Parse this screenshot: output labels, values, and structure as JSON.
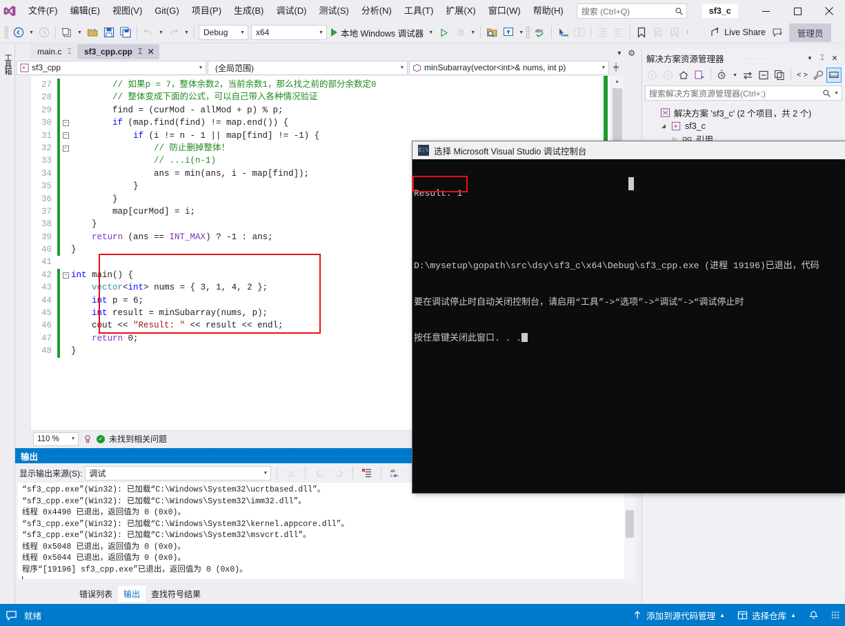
{
  "titlebar": {
    "logo_icon": "visual-studio-logo",
    "menus": [
      {
        "label": "文件(F)"
      },
      {
        "label": "编辑(E)"
      },
      {
        "label": "视图(V)"
      },
      {
        "label": "Git(G)"
      },
      {
        "label": "项目(P)"
      },
      {
        "label": "生成(B)"
      },
      {
        "label": "调试(D)"
      },
      {
        "label": "测试(S)"
      },
      {
        "label": "分析(N)"
      },
      {
        "label": "工具(T)"
      },
      {
        "label": "扩展(X)"
      },
      {
        "label": "窗口(W)"
      },
      {
        "label": "帮助(H)"
      }
    ],
    "search_placeholder": "搜索 (Ctrl+Q)",
    "search_icon": "search-icon",
    "project_chip": "sf3_c",
    "minimize_icon": "minimize-icon",
    "maximize_icon": "maximize-icon",
    "close_icon": "close-icon"
  },
  "toolbar": {
    "back_icon": "navigate-back-icon",
    "forward_icon": "navigate-forward-icon",
    "new_project_icon": "new-project-icon",
    "open_icon": "open-file-icon",
    "save_icon": "save-icon",
    "save_all_icon": "save-all-icon",
    "undo_icon": "undo-icon",
    "redo_icon": "redo-icon",
    "config_value": "Debug",
    "platform_value": "x64",
    "run_label": "本地 Windows 调试器",
    "run_icon": "play-icon",
    "start_no_debug_icon": "start-without-debugging-icon",
    "hot_reload_icon": "hot-reload-icon",
    "folder_search_icon": "folder-search-icon",
    "window_layout_icon": "window-layout-icon",
    "spellcheck_icon": "spellcheck-icon",
    "select_icon": "pointer-select-icon",
    "compare_icon": "compare-icon",
    "indent_icon": "indent-icon",
    "outdent_icon": "outdent-icon",
    "bookmark_icon": "bookmark-icon",
    "bookmark_prev_icon": "bookmark-prev-icon",
    "bookmark_next_icon": "bookmark-next-icon",
    "live_share_label": "Live Share",
    "live_share_icon": "live-share-icon",
    "feedback_icon": "feedback-icon",
    "admin_label": "管理员"
  },
  "left_rail": {
    "toolbox_label": "工具箱"
  },
  "editor": {
    "tabs": [
      {
        "label": "main.c",
        "pin_icon": "pin-icon",
        "active": false
      },
      {
        "label": "sf3_cpp.cpp",
        "pin_icon": "pin-icon",
        "close_icon": "close-icon",
        "active": true
      }
    ],
    "nav": {
      "project_value": "sf3_cpp",
      "project_icon": "cpp-project-icon",
      "scope_value": "(全局范围)",
      "member_value": "minSubarray(vector<int>& nums, int p)",
      "member_icon": "method-icon",
      "split_icon": "split-view-icon"
    },
    "lines": [
      {
        "n": "27",
        "indent": 0,
        "fold": "",
        "chg": true,
        "segs": [
          {
            "t": "        // 如果p = 7，整体余数2，当前余数1，那么找之前的部分余数定0",
            "c": "cm"
          }
        ]
      },
      {
        "n": "28",
        "indent": 0,
        "fold": "",
        "chg": true,
        "segs": [
          {
            "t": "        // 整体变成下面的公式，可以自己带入各种情况验证",
            "c": "cm"
          }
        ]
      },
      {
        "n": "29",
        "indent": 0,
        "fold": "",
        "chg": true,
        "segs": [
          {
            "t": "        find = (curMod - allMod + p) % p;",
            "c": "id"
          }
        ]
      },
      {
        "n": "30",
        "indent": 0,
        "fold": "minus",
        "chg": true,
        "segs": [
          {
            "t": "        ",
            "c": "id"
          },
          {
            "t": "if",
            "c": "kw"
          },
          {
            "t": " (map.find(find) != map.end()) {",
            "c": "id"
          }
        ]
      },
      {
        "n": "31",
        "indent": 0,
        "fold": "minus",
        "chg": true,
        "segs": [
          {
            "t": "            ",
            "c": "id"
          },
          {
            "t": "if",
            "c": "kw"
          },
          {
            "t": " (i != n - 1 || map[find] != -1) {",
            "c": "id"
          }
        ]
      },
      {
        "n": "32",
        "indent": 0,
        "fold": "minus",
        "chg": true,
        "segs": [
          {
            "t": "                // 防止删掉整体！",
            "c": "cm"
          }
        ]
      },
      {
        "n": "33",
        "indent": 0,
        "fold": "",
        "chg": true,
        "segs": [
          {
            "t": "                // ...i(n-1)",
            "c": "cm"
          }
        ]
      },
      {
        "n": "34",
        "indent": 0,
        "fold": "",
        "chg": true,
        "segs": [
          {
            "t": "                ans = min(ans, i - map[find]);",
            "c": "id"
          }
        ]
      },
      {
        "n": "35",
        "indent": 0,
        "fold": "",
        "chg": true,
        "segs": [
          {
            "t": "            }",
            "c": "id"
          }
        ]
      },
      {
        "n": "36",
        "indent": 0,
        "fold": "",
        "chg": true,
        "segs": [
          {
            "t": "        }",
            "c": "id"
          }
        ]
      },
      {
        "n": "37",
        "indent": 0,
        "fold": "",
        "chg": true,
        "segs": [
          {
            "t": "        map[curMod] = i;",
            "c": "id"
          }
        ]
      },
      {
        "n": "38",
        "indent": 0,
        "fold": "",
        "chg": true,
        "segs": [
          {
            "t": "    }",
            "c": "id"
          }
        ]
      },
      {
        "n": "39",
        "indent": 0,
        "fold": "",
        "chg": true,
        "segs": [
          {
            "t": "    ",
            "c": "id"
          },
          {
            "t": "return",
            "c": "kw2"
          },
          {
            "t": " (ans == ",
            "c": "id"
          },
          {
            "t": "INT_MAX",
            "c": "kw2"
          },
          {
            "t": ") ? -1 : ans;",
            "c": "id"
          }
        ]
      },
      {
        "n": "40",
        "indent": 0,
        "fold": "",
        "chg": true,
        "segs": [
          {
            "t": "}",
            "c": "id"
          }
        ]
      },
      {
        "n": "41",
        "indent": 0,
        "fold": "",
        "chg": false,
        "segs": [
          {
            "t": "",
            "c": "id"
          }
        ]
      },
      {
        "n": "42",
        "indent": 0,
        "fold": "minus",
        "chg": true,
        "segs": [
          {
            "t": "int",
            "c": "kw"
          },
          {
            "t": " main() {",
            "c": "id"
          }
        ]
      },
      {
        "n": "43",
        "indent": 0,
        "fold": "",
        "chg": true,
        "segs": [
          {
            "t": "    ",
            "c": "id"
          },
          {
            "t": "vector",
            "c": "ty"
          },
          {
            "t": "<",
            "c": "id"
          },
          {
            "t": "int",
            "c": "kw"
          },
          {
            "t": "> nums = { 3, 1, 4, 2 };",
            "c": "id"
          }
        ]
      },
      {
        "n": "44",
        "indent": 0,
        "fold": "",
        "chg": true,
        "segs": [
          {
            "t": "    ",
            "c": "id"
          },
          {
            "t": "int",
            "c": "kw"
          },
          {
            "t": " p = 6;",
            "c": "id"
          }
        ]
      },
      {
        "n": "45",
        "indent": 0,
        "fold": "",
        "chg": true,
        "segs": [
          {
            "t": "    ",
            "c": "id"
          },
          {
            "t": "int",
            "c": "kw"
          },
          {
            "t": " result = minSubarray(nums, p);",
            "c": "id"
          }
        ]
      },
      {
        "n": "46",
        "indent": 0,
        "fold": "",
        "chg": true,
        "segs": [
          {
            "t": "    cout << ",
            "c": "id"
          },
          {
            "t": "\"Result: \"",
            "c": "st"
          },
          {
            "t": " << result << endl;",
            "c": "id"
          }
        ]
      },
      {
        "n": "47",
        "indent": 0,
        "fold": "",
        "chg": true,
        "segs": [
          {
            "t": "    ",
            "c": "id"
          },
          {
            "t": "return",
            "c": "kw2"
          },
          {
            "t": " 0;",
            "c": "id"
          }
        ]
      },
      {
        "n": "48",
        "indent": 0,
        "fold": "",
        "chg": true,
        "segs": [
          {
            "t": "}",
            "c": "id"
          }
        ]
      }
    ],
    "highlight_color": "#e81010",
    "zoom_value": "110 %",
    "issue_status": "未找到相关问题",
    "issue_icon": "check-circle-icon",
    "intellisense_icon": "intellisense-icon"
  },
  "output_panel": {
    "title": "输出",
    "source_label": "显示输出来源(S):",
    "source_value": "调试",
    "toolbar_icons": [
      "find-message-icon",
      "go-to-previous-icon",
      "go-to-next-icon",
      "clear-all-icon",
      "toggle-word-wrap-icon"
    ],
    "lines": [
      "“sf3_cpp.exe”(Win32): 已加载“C:\\Windows\\System32\\ucrtbased.dll”。",
      "“sf3_cpp.exe”(Win32): 已加载“C:\\Windows\\System32\\imm32.dll”。",
      "线程 0x4490 已退出，返回值为 0 (0x0)。",
      "“sf3_cpp.exe”(Win32): 已加载“C:\\Windows\\System32\\kernel.appcore.dll”。",
      "“sf3_cpp.exe”(Win32): 已加载“C:\\Windows\\System32\\msvcrt.dll”。",
      "线程 0x5048 已退出，返回值为 0 (0x0)。",
      "线程 0x5044 已退出，返回值为 0 (0x0)。",
      "程序“[19196] sf3_cpp.exe”已退出，返回值为 0 (0x0)。"
    ]
  },
  "bottom_tabs": [
    {
      "label": "错误列表",
      "active": false
    },
    {
      "label": "输出",
      "active": true
    },
    {
      "label": "查找符号结果",
      "active": false
    }
  ],
  "solution_explorer": {
    "title": "解决方案资源管理器",
    "dropdown_icon": "chevron-down-icon",
    "pin_icon": "pin-icon",
    "close_icon": "close-icon",
    "toolbar_icons": [
      "navigate-back-icon",
      "navigate-forward-icon",
      "home-icon",
      "pending-changes-icon",
      "show-all-files-icon",
      "sync-with-active-document-icon",
      "collapse-all-icon",
      "refresh-icon",
      "code-view-icon",
      "properties-icon",
      "preview-selected-items-icon"
    ],
    "search_placeholder": "搜索解决方案资源管理器(Ctrl+;)",
    "search_icon": "search-icon",
    "tree": [
      {
        "indent": 0,
        "twisty": "",
        "icon": "solution-icon",
        "label": "解决方案 'sf3_c' (2 个项目，共 2 个)"
      },
      {
        "indent": 1,
        "twisty": "expanded",
        "icon": "cpp-project-icon",
        "label": "sf3_c"
      },
      {
        "indent": 2,
        "twisty": "collapsed",
        "icon": "references-icon",
        "label": "引用"
      }
    ]
  },
  "console_window": {
    "title": "选择 Microsoft Visual Studio 调试控制台",
    "icon": "console-icon",
    "result_line": "Result: 1",
    "lines": [
      "D:\\mysetup\\gopath\\src\\dsy\\sf3_c\\x64\\Debug\\sf3_cpp.exe (进程 19196)已退出，代码",
      "要在调试停止时自动关闭控制台，请启用“工具”->“选项”->“调试”->“调试停止时",
      "按任意键关闭此窗口. . ."
    ],
    "highlight_color": "#e81010"
  },
  "statusbar": {
    "status_icon": "ready-icon",
    "status_text": "就绪",
    "source_control_label": "添加到源代码管理",
    "source_control_icon": "up-arrow-icon",
    "repo_label": "选择仓库",
    "repo_icon": "repository-icon",
    "notifications_icon": "bell-icon",
    "resize_grip_icon": "resize-grip-icon",
    "background_color": "#007acc"
  }
}
